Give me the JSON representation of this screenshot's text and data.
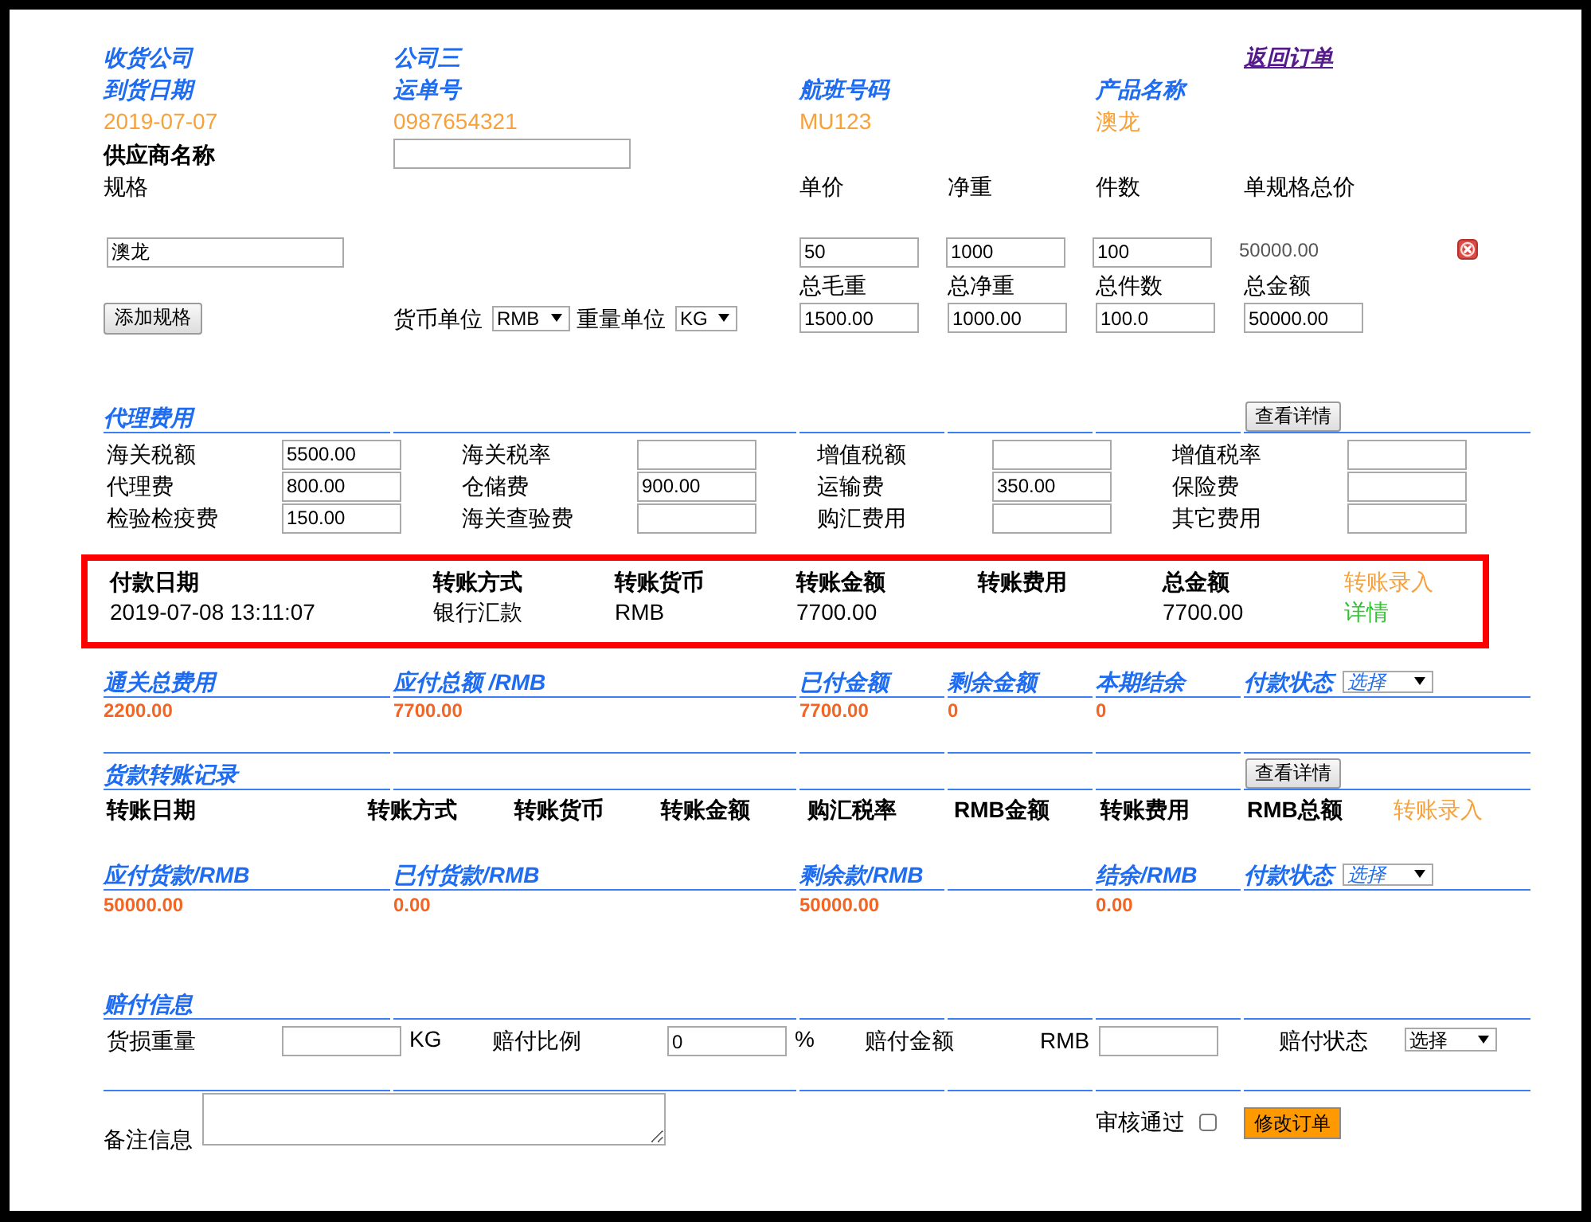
{
  "order_header": {
    "consignee_label": "收货公司",
    "consignee": "公司三",
    "back_link": "返回订单"
  },
  "shipment": [
    {
      "label": "到货日期",
      "value": "2019-07-07"
    },
    {
      "label": "运单号",
      "value": "0987654321"
    },
    {
      "label": "航班号码",
      "value": "MU123"
    },
    {
      "label": "产品名称",
      "value": "澳龙"
    }
  ],
  "supplier": {
    "label": "供应商名称"
  },
  "specs": {
    "label": "规格",
    "columns": [
      "单价",
      "净重",
      "件数",
      "单规格总价"
    ],
    "items": [
      {
        "name": "澳龙",
        "unit_price": "50",
        "net_weight": "1000",
        "pieces": "100",
        "total": "50000.00"
      }
    ],
    "totals": [
      {
        "label": "总毛重",
        "value": "1500.00"
      },
      {
        "label": "总净重",
        "value": "1000.00"
      },
      {
        "label": "总件数",
        "value": "100.0"
      },
      {
        "label": "总金额",
        "value": "50000.00"
      }
    ],
    "add_button": "添加规格",
    "currency_unit": {
      "label": "货币单位",
      "value": "RMB"
    },
    "weight_unit": {
      "label": "重量单位",
      "value": "KG"
    }
  },
  "agency_fees": {
    "title": "代理费用",
    "details_button": "查看详情",
    "fields": [
      {
        "label": "海关税额",
        "value": "5500.00"
      },
      {
        "label": "海关税率"
      },
      {
        "label": "增值税额"
      },
      {
        "label": "增值税率"
      },
      {
        "label": "代理费",
        "value": "800.00"
      },
      {
        "label": "仓储费",
        "value": "900.00"
      },
      {
        "label": "运输费",
        "value": "350.00"
      },
      {
        "label": "保险费"
      },
      {
        "label": "检验检疫费",
        "value": "150.00"
      },
      {
        "label": "海关查验费"
      },
      {
        "label": "购汇费用"
      },
      {
        "label": "其它费用"
      }
    ]
  },
  "payment_record": {
    "highlighted": true,
    "columns": [
      {
        "label": "付款日期",
        "value": "2019-07-08 13:11:07"
      },
      {
        "label": "转账方式",
        "value": "银行汇款"
      },
      {
        "label": "转账货币",
        "value": "RMB"
      },
      {
        "label": "转账金额",
        "value": "7700.00"
      },
      {
        "label": "转账费用"
      },
      {
        "label": "总金额",
        "value": "7700.00"
      }
    ],
    "entry_link": "转账录入",
    "detail_link": "详情"
  },
  "fee_summary": {
    "columns": [
      {
        "label": "通关总费用",
        "value": "2200.00"
      },
      {
        "label": "应付总额 /RMB",
        "value": "7700.00"
      },
      {
        "label": "已付金额",
        "value": "7700.00"
      },
      {
        "label": "剩余金额",
        "value": "0"
      },
      {
        "label": "本期结余",
        "value": "0"
      }
    ],
    "status": {
      "label": "付款状态",
      "value": "选择"
    }
  },
  "goods_transfers": {
    "title": "货款转账记录",
    "details_button": "查看详情",
    "columns": [
      "转账日期",
      "转账方式",
      "转账货币",
      "转账金额",
      "购汇税率",
      "RMB金额",
      "转账费用",
      "RMB总额"
    ],
    "entry_link": "转账录入"
  },
  "goods_summary": {
    "columns": [
      {
        "label": "应付货款/RMB",
        "value": "50000.00"
      },
      {
        "label": "已付货款/RMB",
        "value": "0.00"
      },
      {
        "label": "剩余款/RMB",
        "value": "50000.00"
      },
      {
        "label": "结余/RMB",
        "value": "0.00"
      }
    ],
    "status": {
      "label": "付款状态",
      "value": "选择"
    }
  },
  "compensation": {
    "title": "赔付信息",
    "damaged_weight": {
      "label": "货损重量",
      "unit": "KG"
    },
    "ratio": {
      "label": "赔付比例",
      "value": "0",
      "unit": "%"
    },
    "amount": {
      "label": "赔付金额",
      "currency": "RMB"
    },
    "status": {
      "label": "赔付状态",
      "value": "选择"
    }
  },
  "remarks": {
    "label": "备注信息"
  },
  "review": {
    "label": "审核通过",
    "checked": false
  },
  "submit_button": "修改订单"
}
